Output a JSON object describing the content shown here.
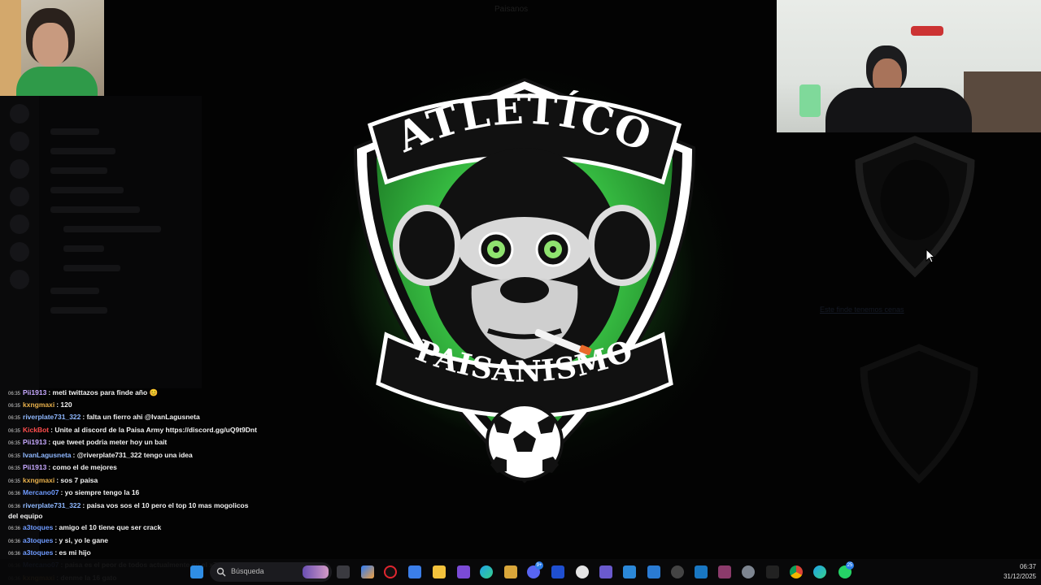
{
  "window": {
    "title": "Paisanos"
  },
  "logo": {
    "top_text": "ATLETÍCO",
    "bottom_text": "PAISANISMO"
  },
  "side_panel": {
    "link_text": "Este finde tenemos cenas"
  },
  "chat": [
    {
      "time": "06:35",
      "user": "Pii1913",
      "user_color": "#c7a9ff",
      "text": ": meti twittazos para finde año 😊"
    },
    {
      "time": "06:35",
      "user": "kxngmaxi",
      "user_color": "#e8b04b",
      "text": ": 120"
    },
    {
      "time": "06:35",
      "user": "riverplate731_322",
      "user_color": "#8fb8ff",
      "text": ": falta un fierro ahi @IvanLagusneta"
    },
    {
      "time": "06:35",
      "user": "KickBot",
      "user_color": "#ff4d4d",
      "text": ": Unite al discord de la Paisa Army https://discord.gg/uQ9t9Dnt"
    },
    {
      "time": "06:35",
      "user": "Pii1913",
      "user_color": "#c7a9ff",
      "text": ": que tweet podria meter hoy un bait"
    },
    {
      "time": "06:35",
      "user": "IvanLagusneta",
      "user_color": "#8fb8ff",
      "text": ": @riverplate731_322 tengo una idea"
    },
    {
      "time": "06:35",
      "user": "Pii1913",
      "user_color": "#c7a9ff",
      "text": ": como el de mejores"
    },
    {
      "time": "06:35",
      "user": "kxngmaxi",
      "user_color": "#e8b04b",
      "text": ": sos 7 paisa"
    },
    {
      "time": "06:36",
      "user": "Mercano07",
      "user_color": "#6f9bff",
      "text": ": yo siempre tengo la 16"
    },
    {
      "time": "06:36",
      "user": "riverplate731_322",
      "user_color": "#8fb8ff",
      "text": ": paisa vos sos el 10 pero el top 10 mas mogolicos del equipo"
    },
    {
      "time": "06:36",
      "user": "a3toques",
      "user_color": "#6f9bff",
      "text": ": amigo el 10 tiene que ser crack"
    },
    {
      "time": "06:36",
      "user": "a3toques",
      "user_color": "#6f9bff",
      "text": ": y si, yo le gane"
    },
    {
      "time": "06:36",
      "user": "a3toques",
      "user_color": "#6f9bff",
      "text": ": es mi hijo"
    },
    {
      "time": "06:36",
      "user": "Mercano07",
      "user_color": "#6f9bff",
      "text": ": paisa es el peor de todos actualmente en el x7"
    },
    {
      "time": "06:36",
      "user": "kxngmaxi",
      "user_color": "#e8b04b",
      "text": ": denme la 16 gato"
    }
  ],
  "taskbar": {
    "search_placeholder": "Búsqueda",
    "clock_time": "06:37",
    "clock_date": "31/12/2025",
    "discord_badge": "9+",
    "whatsapp_badge": "25",
    "apps": [
      "windows-start",
      "search",
      "widgets",
      "task-view",
      "copilot",
      "opera",
      "store",
      "file-explorer",
      "pen",
      "edge",
      "vivaldi",
      "discord",
      "webstorm",
      "ccleaner",
      "app-grid",
      "visual-studio",
      "notepad",
      "chrome-ext",
      "outlook",
      "winrar",
      "settings",
      "terminal",
      "chrome",
      "edge-app",
      "whatsapp"
    ]
  }
}
